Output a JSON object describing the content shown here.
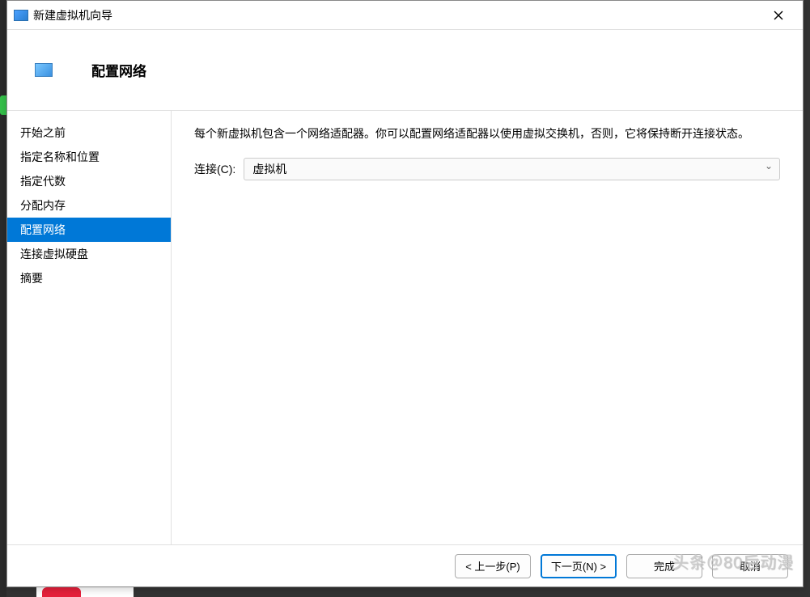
{
  "titlebar": {
    "title": "新建虚拟机向导"
  },
  "header": {
    "title": "配置网络"
  },
  "sidebar": {
    "items": [
      {
        "label": "开始之前"
      },
      {
        "label": "指定名称和位置"
      },
      {
        "label": "指定代数"
      },
      {
        "label": "分配内存"
      },
      {
        "label": "配置网络",
        "active": true
      },
      {
        "label": "连接虚拟硬盘"
      },
      {
        "label": "摘要"
      }
    ]
  },
  "content": {
    "description": "每个新虚拟机包含一个网络适配器。你可以配置网络适配器以使用虚拟交换机，否则，它将保持断开连接状态。",
    "connection_label": "连接(C):",
    "connection_value": "虚拟机"
  },
  "footer": {
    "prev": "< 上一步(P)",
    "next": "下一页(N) >",
    "finish": "完成",
    "cancel": "取消"
  },
  "watermark": "头条＠80后动漫"
}
